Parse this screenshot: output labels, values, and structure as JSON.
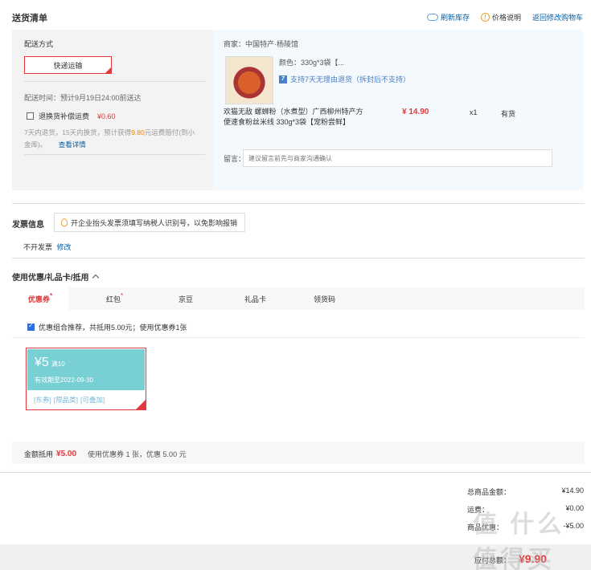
{
  "shipping_list": {
    "title": "送货清单",
    "links": {
      "refresh": "刷新库存",
      "price_note": "价格说明",
      "back_cart": "返回修改购物车"
    },
    "method_label": "配送方式",
    "method_value": "快递运输",
    "delivery_time": "配送时间：预计9月19日24:00前送达",
    "insurance_label": "退换货补偿运费",
    "insurance_price": "¥0.60",
    "insurance_desc_1": "7天内退货，15天内换货，预计获得",
    "insurance_desc_amount": "9.80",
    "insurance_desc_2": "元运费赔付(到小",
    "insurance_desc_3": "金库)。",
    "view_detail": "查看详情",
    "merchant": "商家：中国特产·杨陵馆",
    "product_spec": "颜色：330g*3袋【...",
    "return_policy": "支持7天无理由退货（拆封后不支持）",
    "product_name_1": "欢猫无敌 螺蛳粉（水煮型）广西柳州特产方",
    "product_name_2": "便速食粉丝米线 330g*3袋【宠粉尝鲜】",
    "product_price": "¥ 14.90",
    "product_qty": "x1",
    "product_stock": "有货",
    "note_label": "留言：",
    "note_placeholder": "建议留言前先与商家沟通确认"
  },
  "invoice": {
    "title": "发票信息",
    "tip": "开企业抬头发票须填写纳税人识别号，以免影响报销",
    "value": "不开发票",
    "edit": "修改"
  },
  "discount": {
    "title": "使用优惠/礼品卡/抵用",
    "tabs": [
      "优惠券",
      "红包",
      "京豆",
      "礼品卡",
      "领货码"
    ],
    "combo_text": "优惠组合推荐，共抵用5.00元；使用优惠券1张",
    "coupon": {
      "amount": "¥5",
      "condition": "满10",
      "expiry": "有效期至2022-09-30",
      "tags": [
        "[东券]",
        "[限品类]",
        "[可叠加]"
      ]
    },
    "sum_label": "金额抵用",
    "sum_amount": "¥5.00",
    "sum_desc": "使用优惠券 1 张，优惠 5.00 元"
  },
  "totals": {
    "goods_label": "总商品金额：",
    "goods_value": "¥14.90",
    "row2_label": "运费：",
    "row2_value": "¥0.00",
    "row3_label": "商品优惠：",
    "row3_value": "-¥5.00",
    "final_label": "应付总额：",
    "final_value": "¥9.90"
  },
  "watermark": "值 什么值得买",
  "colors": {
    "accent": "#e4393c",
    "link": "#005ea7",
    "coupon": "#78cfd4"
  }
}
